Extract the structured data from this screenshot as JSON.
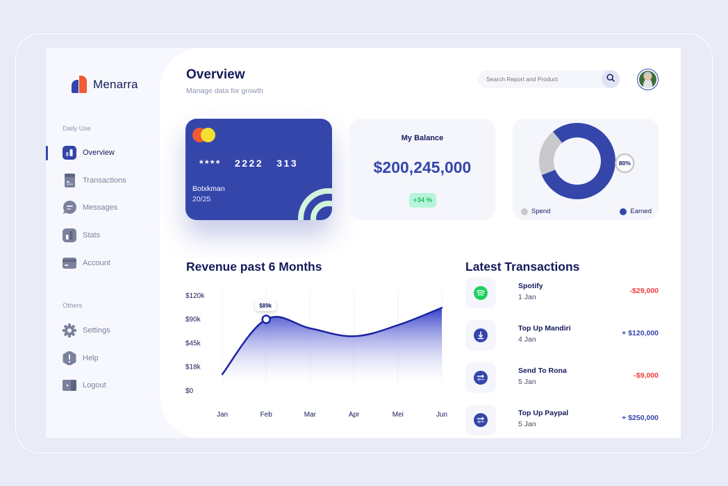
{
  "app": {
    "brand": "Menarra"
  },
  "sidebar": {
    "sections": [
      {
        "label": "Daily Use",
        "items": [
          {
            "label": "Overview",
            "icon": "overview-icon",
            "active": true
          },
          {
            "label": "Transactions",
            "icon": "transactions-icon"
          },
          {
            "label": "Messages",
            "icon": "messages-icon"
          },
          {
            "label": "Stats",
            "icon": "stats-icon"
          },
          {
            "label": "Account",
            "icon": "account-icon"
          }
        ]
      },
      {
        "label": "Others",
        "items": [
          {
            "label": "Settings",
            "icon": "gear-icon"
          },
          {
            "label": "Help",
            "icon": "help-icon"
          },
          {
            "label": "Logout",
            "icon": "logout-icon"
          }
        ]
      }
    ]
  },
  "header": {
    "title": "Overview",
    "subtitle": "Manage data for growth",
    "search_placeholder": "Search Report and Product"
  },
  "card": {
    "number": "****   2222   313",
    "holder": "Botxkman",
    "expiry": "20/25"
  },
  "balance": {
    "label": "My Balance",
    "amount": "$200,245,000",
    "change": "+34 %"
  },
  "donut": {
    "earned_percent": 80,
    "label": "80%",
    "legend": [
      {
        "label": "Spend",
        "color": "#c9c9cc"
      },
      {
        "label": "Earned",
        "color": "#3546ab"
      }
    ]
  },
  "revenue": {
    "title": "Revenue past 6 Months"
  },
  "chart_data": {
    "type": "area",
    "title": "Revenue past 6 Months",
    "x": [
      "Jan",
      "Feb",
      "Mar",
      "Apr",
      "Mei",
      "Jun"
    ],
    "y_ticks": [
      "$120k",
      "$90k",
      "$45k",
      "$18k",
      "$0"
    ],
    "y_tick_values": [
      120,
      90,
      45,
      18,
      0
    ],
    "series": [
      {
        "name": "Revenue ($k)",
        "values": [
          12,
          89,
          72,
          57,
          78,
          104
        ]
      }
    ],
    "highlight": {
      "x": "Feb",
      "label": "$89k"
    },
    "grid": "vertical",
    "color": "#1a23a0"
  },
  "transactions": {
    "title": "Latest Transactions",
    "items": [
      {
        "name": "Spotify",
        "date": "1 Jan",
        "amount": "-$29,000",
        "type": "neg",
        "icon": "spotify-icon"
      },
      {
        "name": "Top Up Mandiri",
        "date": "4 Jan",
        "amount": "+ $120,000",
        "type": "pos",
        "icon": "download-icon"
      },
      {
        "name": "Send To Rona",
        "date": "5 Jan",
        "amount": "-$9,000",
        "type": "neg",
        "icon": "transfer-icon"
      },
      {
        "name": "Top Up Paypal",
        "date": "5 Jan",
        "amount": "+ $250,000",
        "type": "pos",
        "icon": "transfer-icon"
      }
    ]
  }
}
